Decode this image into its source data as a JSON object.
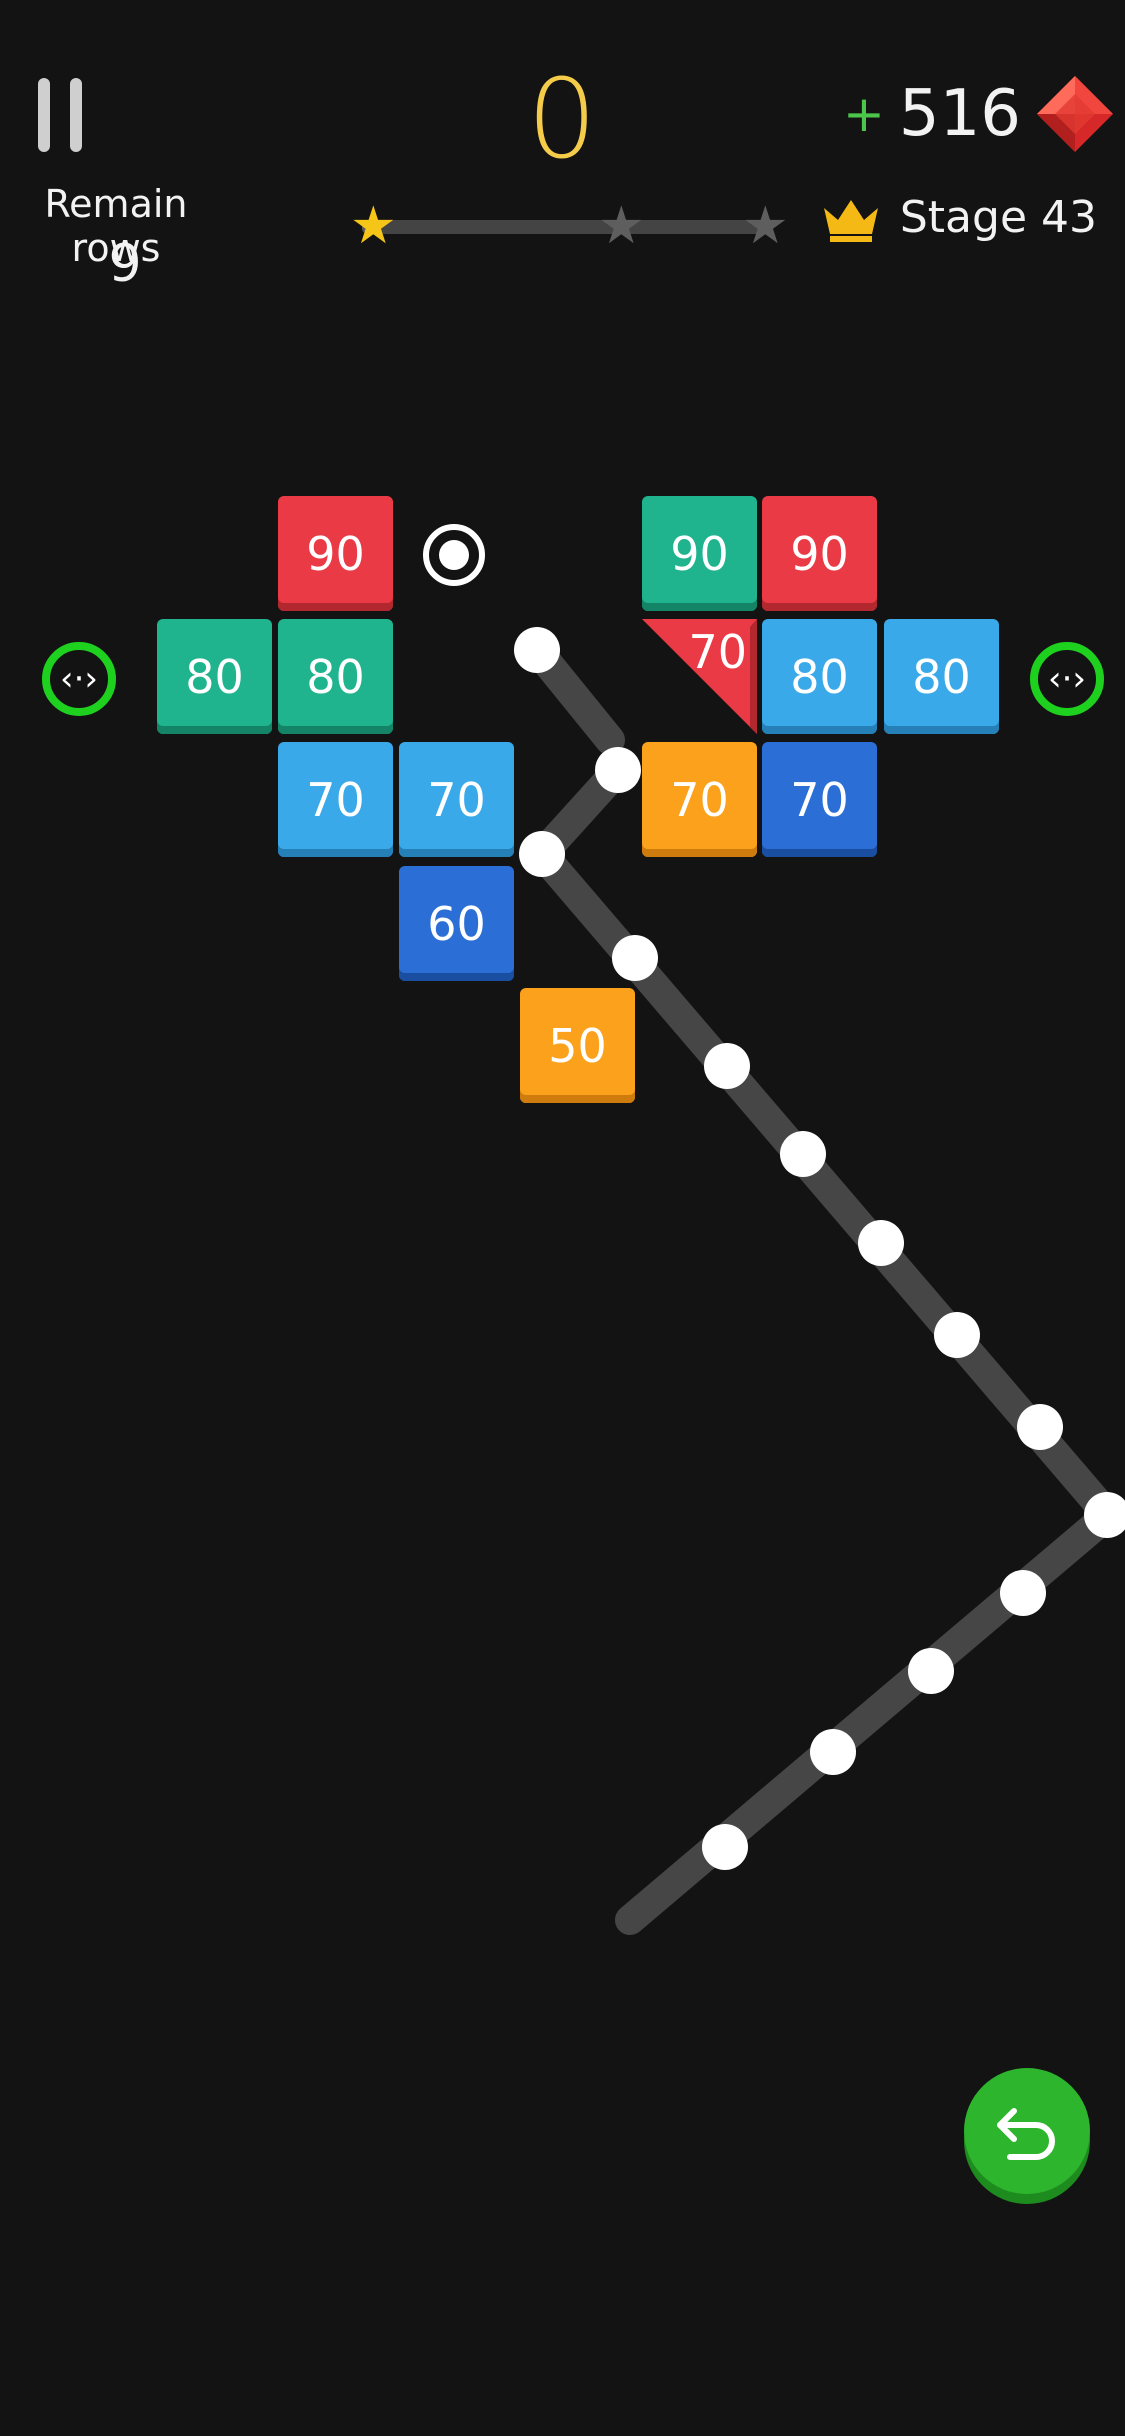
{
  "hud": {
    "remain_label": "Remain rows",
    "remain_value": "9",
    "score": "0",
    "plus": "+",
    "gems": "516",
    "stage": "Stage 43",
    "star_progress_fraction": 0.03,
    "stars_earned": 1,
    "stars_total": 3,
    "colors": {
      "score": "#f5cc4a",
      "plus": "#4cc64a",
      "star_on": "#f5c518",
      "star_off": "#5e5e5e"
    }
  },
  "bricks": [
    {
      "label": "90",
      "color": "red"
    },
    {
      "label": "90",
      "color": "teal"
    },
    {
      "label": "90",
      "color": "red"
    },
    {
      "label": "80",
      "color": "teal"
    },
    {
      "label": "80",
      "color": "teal"
    },
    {
      "label": "70",
      "color": "red-triangle"
    },
    {
      "label": "80",
      "color": "sky"
    },
    {
      "label": "80",
      "color": "sky"
    },
    {
      "label": "70",
      "color": "sky"
    },
    {
      "label": "70",
      "color": "sky"
    },
    {
      "label": "70",
      "color": "orange"
    },
    {
      "label": "70",
      "color": "blue"
    },
    {
      "label": "60",
      "color": "blue"
    },
    {
      "label": "50",
      "color": "orange"
    }
  ],
  "icons": {
    "pause": "pause-icon",
    "gem": "diamond-icon",
    "crown": "crown-icon",
    "portal": "portal-icon",
    "extra_ball": "extra-ball-icon",
    "undo": "undo-icon"
  }
}
